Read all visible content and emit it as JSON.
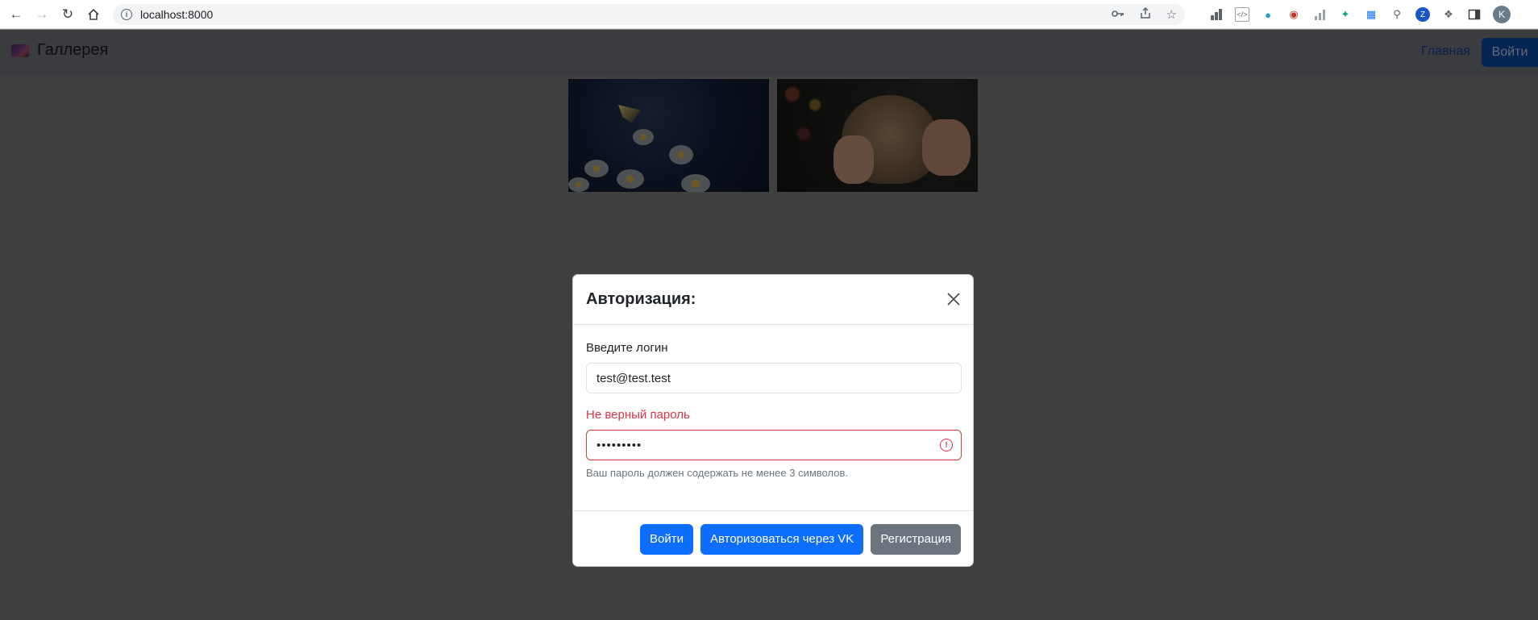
{
  "browser": {
    "url": "localhost:8000",
    "profile_initial": "K"
  },
  "navbar": {
    "brand": "Галлерея",
    "home_link": "Главная",
    "login_button": "Войти"
  },
  "gallery": {
    "images": [
      {
        "subject": "butterfly-on-daisies"
      },
      {
        "subject": "cat-in-hands"
      }
    ]
  },
  "modal": {
    "title": "Авторизация:",
    "login_label": "Введите логин",
    "login_value": "test@test.test",
    "password_error": "Не верный пароль",
    "password_value": "•••••••••",
    "password_help": "Ваш пароль должен содержать не менее 3 символов.",
    "buttons": {
      "submit": "Войти",
      "vk": "Авторизоваться через VK",
      "register": "Регистрация"
    }
  },
  "colors": {
    "primary": "#0d6efd",
    "secondary": "#6c757d",
    "danger": "#dc3545"
  }
}
